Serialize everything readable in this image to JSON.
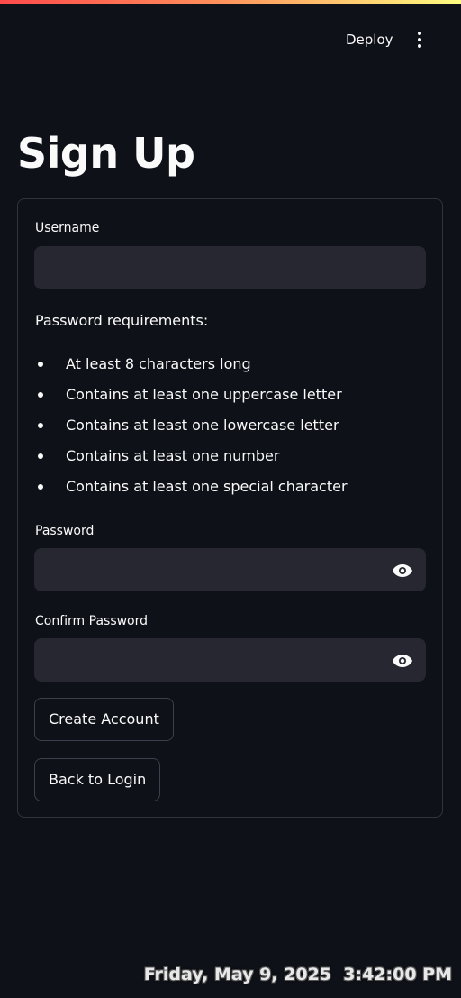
{
  "header": {
    "deploy_label": "Deploy",
    "menu_icon": "kebab-menu-icon"
  },
  "page": {
    "title": "Sign Up"
  },
  "form": {
    "username": {
      "label": "Username",
      "value": "",
      "placeholder": ""
    },
    "requirements": {
      "heading": "Password requirements:",
      "items": [
        "At least 8 characters long",
        "Contains at least one uppercase letter",
        "Contains at least one lowercase letter",
        "Contains at least one number",
        "Contains at least one special character"
      ]
    },
    "password": {
      "label": "Password",
      "value": "",
      "placeholder": "",
      "toggle_icon": "eye-icon"
    },
    "confirm_password": {
      "label": "Confirm Password",
      "value": "",
      "placeholder": "",
      "toggle_icon": "eye-icon"
    },
    "create_account_label": "Create Account",
    "back_to_login_label": "Back to Login"
  },
  "overlay": {
    "timestamp": "Friday, May 9, 2025  3:42:00 PM"
  },
  "colors": {
    "background": "#0e1117",
    "input_background": "#262730",
    "border": "#31333f",
    "text": "#fafafa",
    "accent_gradient_start": "#ff4b4b",
    "accent_gradient_end": "#fffd80"
  }
}
